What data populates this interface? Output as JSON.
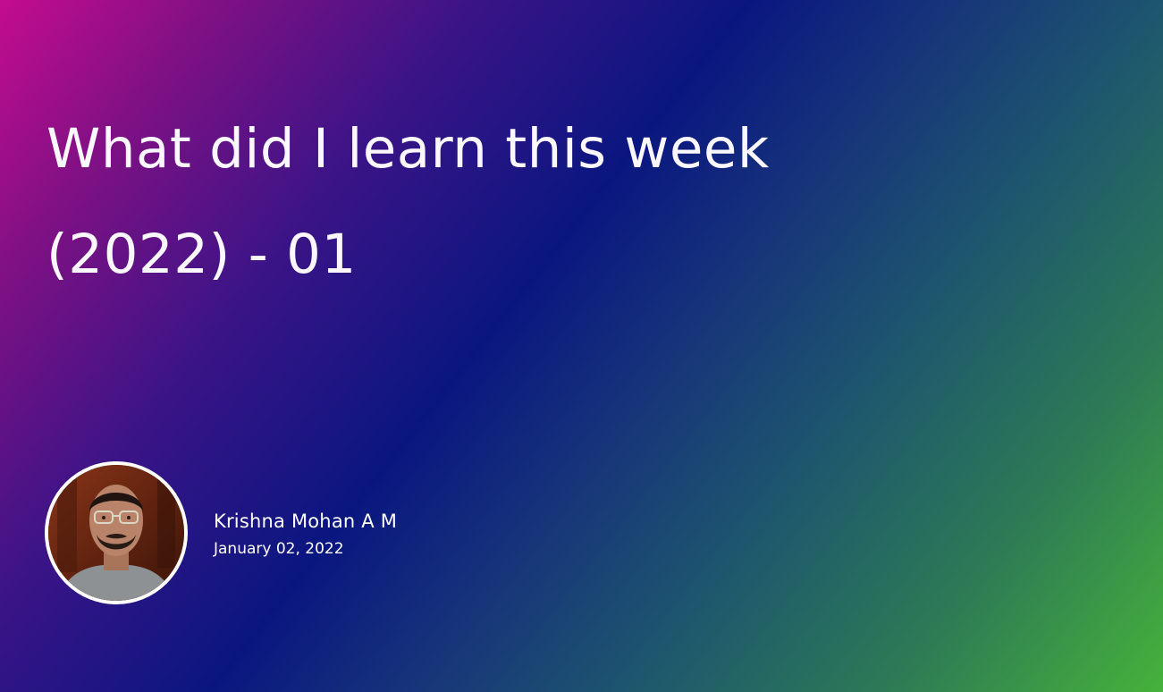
{
  "post": {
    "title_line1": "What did I learn this week",
    "title_line2": "(2022) - 01"
  },
  "author": {
    "name": "Krishna Mohan A M",
    "date": "January 02, 2022",
    "avatar": "author-photo"
  },
  "colors": {
    "gradient_start": "#c40c8f",
    "gradient_mid": "#0a1680",
    "gradient_end": "#46b23a",
    "text": "#ffffff"
  }
}
